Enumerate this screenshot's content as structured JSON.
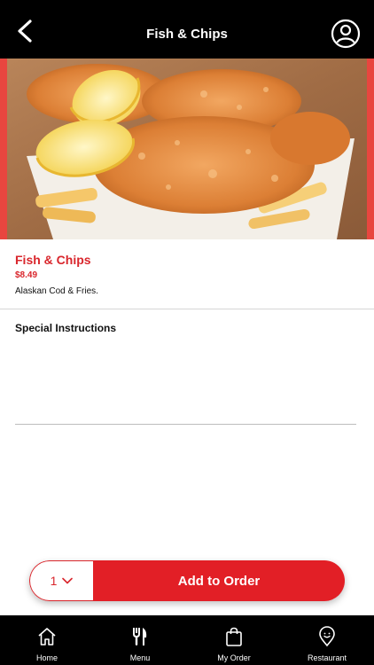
{
  "header": {
    "title": "Fish & Chips",
    "back_icon": "chevron-left-icon",
    "profile_icon": "user-circle-icon"
  },
  "item": {
    "name": "Fish & Chips",
    "price": "$8.49",
    "description": "Alaskan Cod & Fries."
  },
  "instructions": {
    "label": "Special Instructions",
    "value": ""
  },
  "order": {
    "quantity": "1",
    "add_label": "Add to Order"
  },
  "tabs": [
    {
      "label": "Home",
      "icon": "home-icon"
    },
    {
      "label": "Menu",
      "icon": "fork-knife-icon"
    },
    {
      "label": "My Order",
      "icon": "shopping-bag-icon"
    },
    {
      "label": "Restaurant",
      "icon": "location-pin-icon"
    }
  ],
  "colors": {
    "accent": "#e21f26",
    "topbar": "#000000",
    "tabbar": "#000000"
  }
}
